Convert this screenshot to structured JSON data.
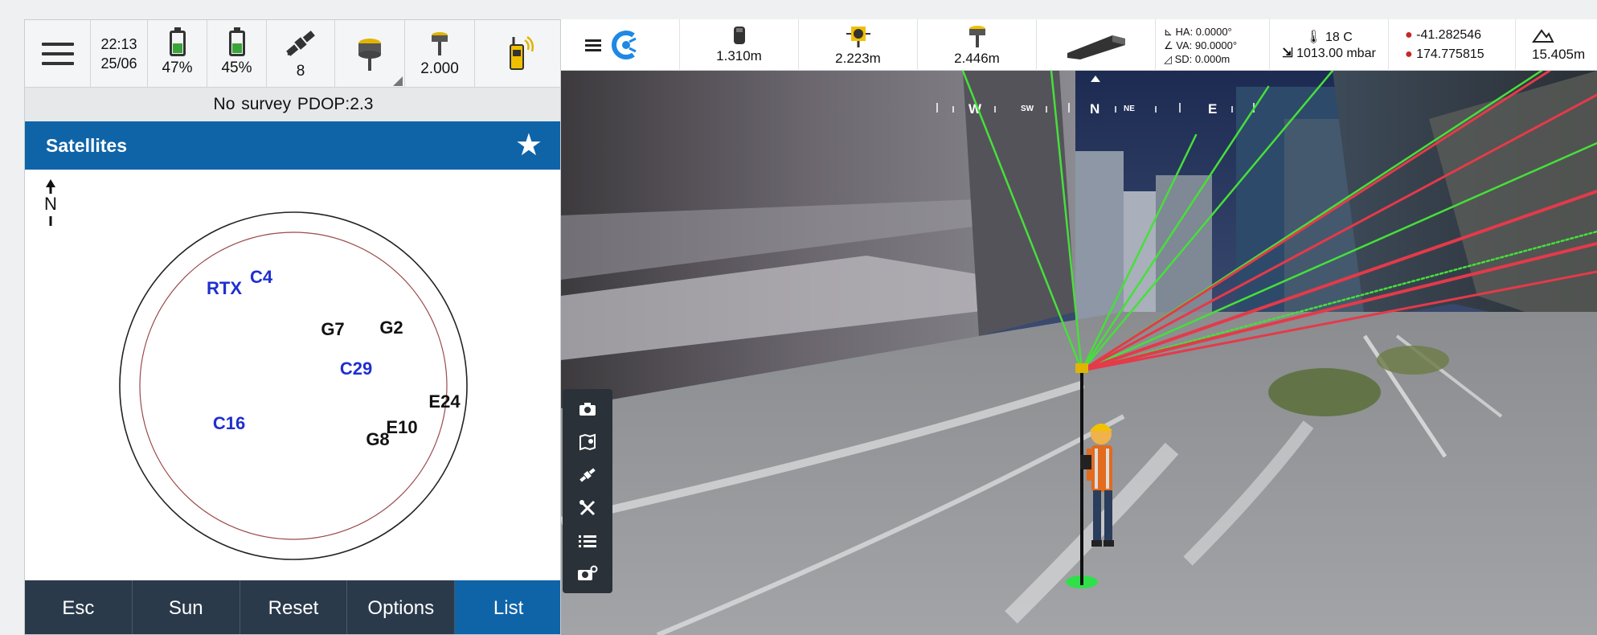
{
  "statusbar": {
    "time": "22:13",
    "date": "25/06",
    "battery1": {
      "label": "47%",
      "level": 0.47
    },
    "battery2": {
      "label": "45%",
      "level": 0.45
    },
    "satellites_count": "8",
    "antenna_height": "2.000"
  },
  "survey_status": "No survey  PDOP:2.3",
  "panel": {
    "title": "Satellites",
    "north_label": "N"
  },
  "skyplot": {
    "satellites": [
      {
        "id": "RTX",
        "system": "bds"
      },
      {
        "id": "C4",
        "system": "bds"
      },
      {
        "id": "G7",
        "system": "gps"
      },
      {
        "id": "G2",
        "system": "gps"
      },
      {
        "id": "C29",
        "system": "bds"
      },
      {
        "id": "E24",
        "system": "gps"
      },
      {
        "id": "C16",
        "system": "bds"
      },
      {
        "id": "E10",
        "system": "gps"
      },
      {
        "id": "G8",
        "system": "gps"
      }
    ]
  },
  "softkeys": [
    "Esc",
    "Sun",
    "Reset",
    "Options",
    "List"
  ],
  "topbar": {
    "dist1": "1.310m",
    "dist2": "2.223m",
    "dist3": "2.446m",
    "ha": "HA: 0.0000°",
    "va": "VA: 90.0000°",
    "sd": "SD: 0.000m",
    "temperature": "18  C",
    "pressure": "1013.00 mbar",
    "latitude": "-41.282546",
    "longitude": "174.775815",
    "elevation": "15.405m"
  },
  "compass": [
    "W",
    "SW",
    "N",
    "NE",
    "E"
  ],
  "colors": {
    "accent": "#0f64a8",
    "softkey_bg": "#2b3a4b",
    "bds_sat": "#1f2fd0",
    "ray_green": "#46e03a",
    "ray_red": "#e43a4a"
  }
}
